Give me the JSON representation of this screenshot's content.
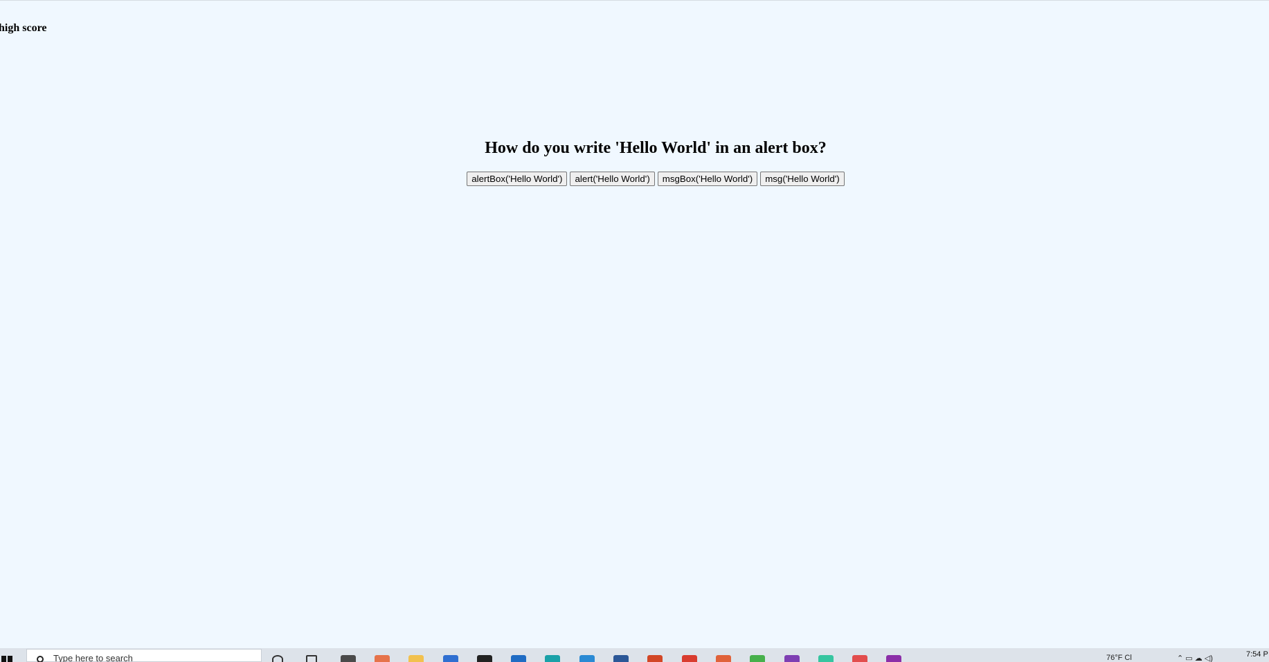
{
  "page": {
    "high_score_label": "high score",
    "question": "How do you write 'Hello World' in an alert box?",
    "answers": [
      "alertBox('Hello World')",
      "alert('Hello World')",
      "msgBox('Hello World')",
      "msg('Hello World')"
    ]
  },
  "taskbar": {
    "search_placeholder": "Type here to search",
    "weather": "76°F Cl",
    "clock_time": "7:54 P",
    "icons": [
      {
        "name": "cortana-icon",
        "color": "#333333"
      },
      {
        "name": "task-view-icon",
        "color": "#333333"
      },
      {
        "name": "briefcase-icon",
        "color": "#4a4a4a"
      },
      {
        "name": "paint-icon",
        "color": "#e6734a"
      },
      {
        "name": "folder-icon",
        "color": "#f2c14e"
      },
      {
        "name": "todo-icon",
        "color": "#2f6fd1"
      },
      {
        "name": "dropbox-icon",
        "color": "#222222"
      },
      {
        "name": "outlook-icon",
        "color": "#1f6cc4"
      },
      {
        "name": "edge-icon",
        "color": "#1aa1a8"
      },
      {
        "name": "vscode-icon",
        "color": "#2a8ad4"
      },
      {
        "name": "word-icon",
        "color": "#2b5797"
      },
      {
        "name": "office-icon",
        "color": "#d24726"
      },
      {
        "name": "chrome-icon",
        "color": "#d93c2f"
      },
      {
        "name": "app-icon",
        "color": "#e0623a"
      },
      {
        "name": "green-app-icon",
        "color": "#46b04b"
      },
      {
        "name": "purple-app-icon",
        "color": "#7e3fb3"
      },
      {
        "name": "slack-icon",
        "color": "#36c5a0"
      },
      {
        "name": "red-app-icon",
        "color": "#e24d4d"
      },
      {
        "name": "onenote-icon",
        "color": "#8b2fa8"
      }
    ]
  }
}
